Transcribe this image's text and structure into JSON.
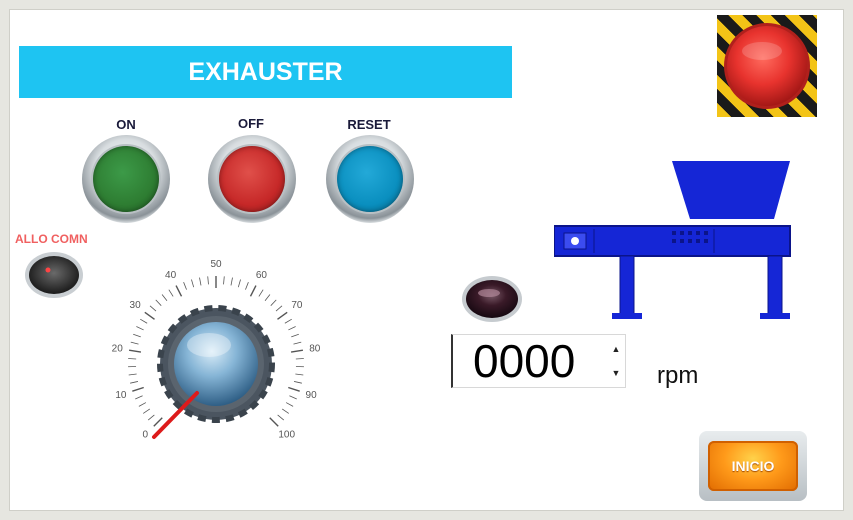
{
  "title": "EXHAUSTER",
  "buttons": {
    "on": {
      "label": "ON",
      "color": "#2e7d32"
    },
    "off": {
      "label": "OFF",
      "color": "#c62828"
    },
    "reset": {
      "label": "RESET",
      "color": "#0a8fbf"
    }
  },
  "alarm": {
    "label": "ALLO COMN",
    "color": "#f06060"
  },
  "dial": {
    "ticks": [
      "0",
      "10",
      "20",
      "30",
      "40",
      "50",
      "60",
      "70",
      "80",
      "90",
      "100"
    ],
    "min": 0,
    "max": 100,
    "value": 0
  },
  "rpm": {
    "value": "0000",
    "unit": "rpm"
  },
  "start_button": {
    "label": "INICIO"
  },
  "colors": {
    "title_bar": "#1ec4f2",
    "machine": "#1526d6",
    "estop_red": "#e8332e",
    "stripe_yellow": "#f3c417"
  },
  "icons": {
    "emergency_stop": "emergency-stop-icon",
    "machine": "shredder-machine-icon",
    "indicator": "indicator-lamp-icon"
  }
}
